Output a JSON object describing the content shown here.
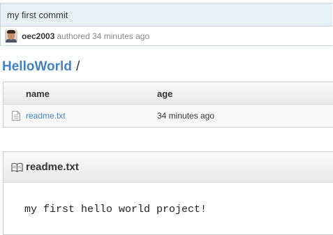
{
  "commit": {
    "message": "my first commit",
    "author": "oec2003",
    "authored_text": "authored 34 minutes ago"
  },
  "breadcrumb": {
    "repo": "HelloWorld",
    "separator": "/"
  },
  "file_table": {
    "columns": [
      "name",
      "age"
    ],
    "rows": [
      {
        "name": "readme.txt",
        "age": "34 minutes ago",
        "icon": "text-file-icon"
      }
    ]
  },
  "readme": {
    "title": "readme.txt",
    "icon": "book-icon",
    "content": "my first hello world project!"
  },
  "colors": {
    "link": "#4183c4",
    "commit_header_bg": "#e6f1f6",
    "text": "#333333",
    "muted": "#888888"
  }
}
